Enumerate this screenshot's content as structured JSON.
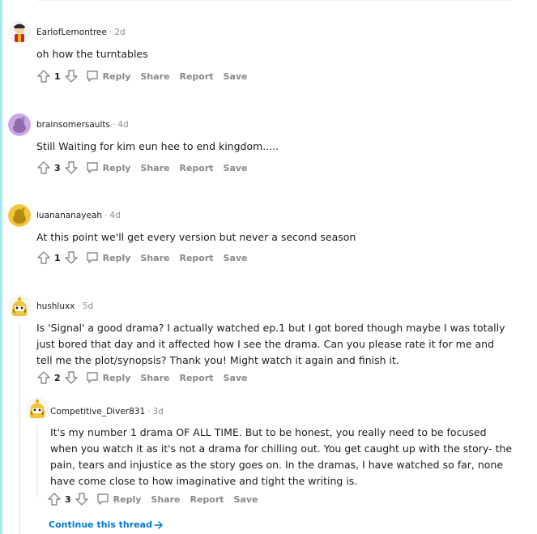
{
  "actions": {
    "reply": "Reply",
    "share": "Share",
    "report": "Report",
    "save": "Save"
  },
  "comments": [
    {
      "author": "EarlofLemontree",
      "time": "2d",
      "body": "oh how the turntables",
      "score": "1"
    },
    {
      "author": "brainsomersaults",
      "time": "4d",
      "body": "Still Waiting for kim eun hee to end kingdom.....",
      "score": "3"
    },
    {
      "author": "luanananayeah",
      "time": "4d",
      "body": "At this point we'll get every version but never a second season",
      "score": "1"
    },
    {
      "author": "hushluxx",
      "time": "5d",
      "body": "Is 'Signal' a good drama? I actually watched ep.1 but I got bored though maybe I was totally just bored that day and it affected how I see the drama. Can you please rate it for me and tell me the plot/synopsis? Thank you! Might watch it again and finish it.",
      "score": "2"
    }
  ],
  "reply": {
    "author": "Competitive_Diver831",
    "time": "3d",
    "body": "It's my number 1 drama OF ALL TIME. But to be honest, you really need to be focused when you watch it as it's not a drama for chilling out. You get caught up with the story- the pain, tears and injustice as the story goes on. In the dramas, I have watched so far, none have come close to how imaginative and tight the writing is.",
    "score": "3"
  },
  "continue_thread": "Continue this thread",
  "colors": {
    "link": "#0079d3",
    "muted": "#878a8c",
    "thread_accent": "#a6e8f0",
    "avatar_purple": "#c9a6e6",
    "avatar_yellow": "#f2c53d"
  }
}
